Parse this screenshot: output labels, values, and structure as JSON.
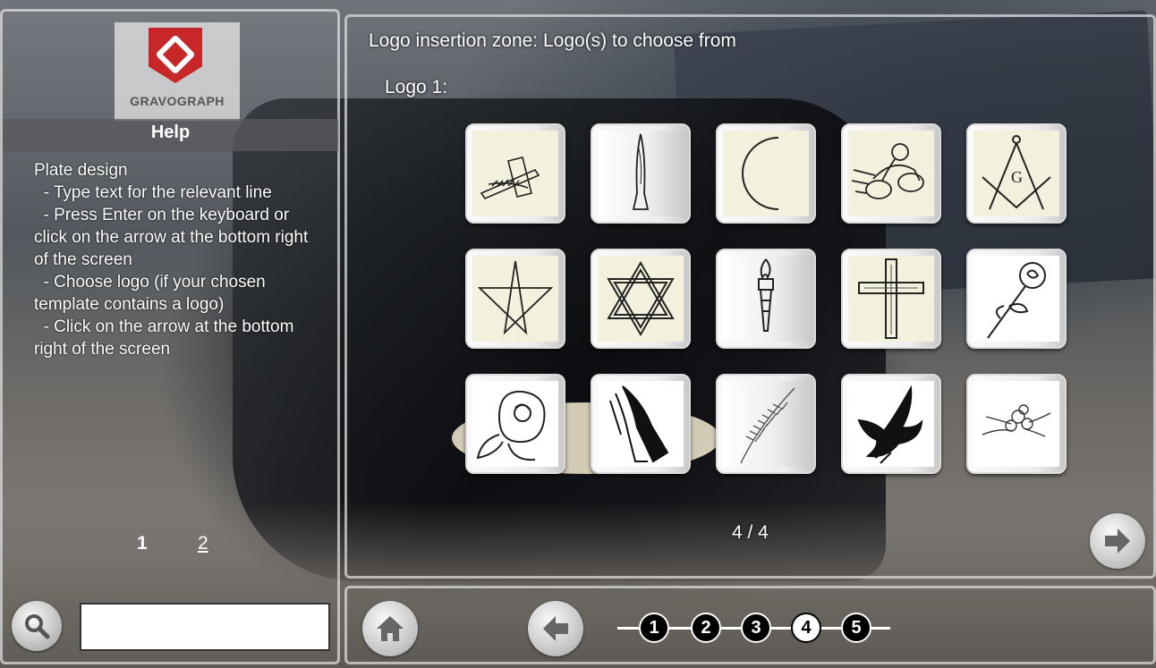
{
  "brand": {
    "name": "GRAVOGRAPH"
  },
  "help": {
    "title": "Help",
    "lines": [
      "Plate design",
      "  - Type text for the relevant line",
      "  - Press Enter on the keyboard or click on the arrow at the bottom right of the screen",
      "  - Choose logo (if your chosen template contains a logo)",
      "  - Click on the arrow at the bottom right of the screen"
    ],
    "pages": [
      "1",
      "2"
    ]
  },
  "search": {
    "value": "",
    "icon": "magnifier-icon"
  },
  "main": {
    "zone_title": "Logo insertion zone:  Logo(s) to choose from",
    "logo_label": "Logo 1:",
    "logos": [
      "cross-with-palm-icon",
      "candle-flame-icon",
      "crescent-moon-icon",
      "motorcycle-rider-icon",
      "masonic-square-compass-icon",
      "pentagram-star-icon",
      "star-of-david-icon",
      "torch-icon",
      "latin-cross-icon",
      "rose-icon",
      "rose-bloom-icon",
      "praying-hands-icon",
      "wheat-ear-icon",
      "dove-with-branch-icon",
      "flower-bouquet-icon"
    ],
    "pager": "4 / 4"
  },
  "nav": {
    "steps": [
      "1",
      "2",
      "3",
      "4",
      "5"
    ],
    "active_step": "4"
  }
}
